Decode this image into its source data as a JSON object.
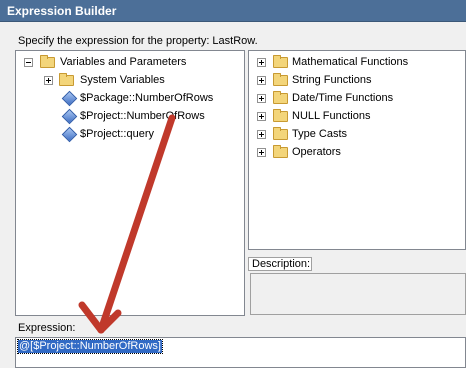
{
  "window": {
    "title": "Expression Builder"
  },
  "prompt": "Specify the expression for the property: LastRow.",
  "left_tree": [
    {
      "label": "Variables and Parameters",
      "icon": "folder-icon"
    },
    {
      "label": "System Variables",
      "icon": "folder-icon"
    },
    {
      "label": "$Package::NumberOfRows",
      "icon": "parameter-icon"
    },
    {
      "label": "$Project::NumberOfRows",
      "icon": "parameter-icon"
    },
    {
      "label": "$Project::query",
      "icon": "parameter-icon"
    }
  ],
  "right_tree": [
    {
      "label": "Mathematical Functions",
      "icon": "folder-icon"
    },
    {
      "label": "String Functions",
      "icon": "folder-icon"
    },
    {
      "label": "Date/Time Functions",
      "icon": "folder-icon"
    },
    {
      "label": "NULL Functions",
      "icon": "folder-icon"
    },
    {
      "label": "Type Casts",
      "icon": "folder-icon"
    },
    {
      "label": "Operators",
      "icon": "folder-icon"
    }
  ],
  "description": {
    "label": "Description:"
  },
  "expression": {
    "label": "Expression:",
    "value": "@[$Project::NumberOfRows]"
  },
  "colors": {
    "titlebar": "#4c6f98",
    "selection": "#316ac5",
    "arrow": "#c0392b"
  }
}
